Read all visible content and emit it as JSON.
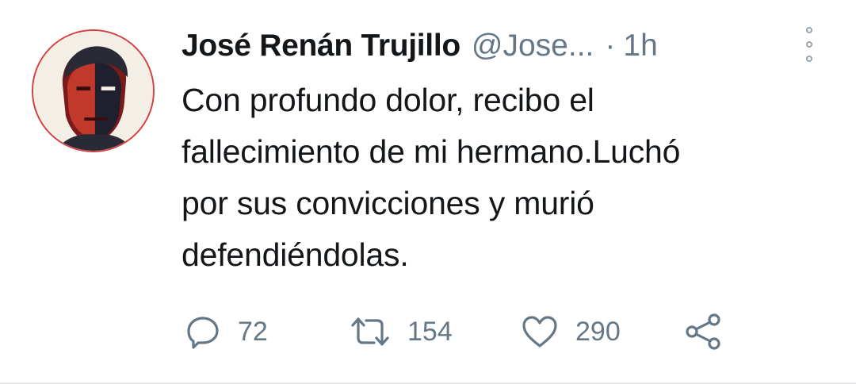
{
  "tweet": {
    "author_name": "José Renán Trujillo",
    "handle": "@Jose...",
    "separator": "·",
    "time": "1h",
    "text": "Con profundo dolor, recibo el\nfallecimiento de mi hermano.Luchó\npor sus convicciones y murió\ndefendiéndolas.",
    "avatar_icon": "profile-portrait",
    "menu_icon": "more-vertical-icon"
  },
  "actions": {
    "reply": {
      "icon": "reply-icon",
      "count": "72"
    },
    "retweet": {
      "icon": "retweet-icon",
      "count": "154"
    },
    "like": {
      "icon": "heart-icon",
      "count": "290"
    },
    "share": {
      "icon": "share-icon"
    }
  },
  "colors": {
    "name": "#14171a",
    "secondary": "#657786",
    "avatar_ring": "#d63f3f",
    "divider": "#e6ecf0"
  }
}
